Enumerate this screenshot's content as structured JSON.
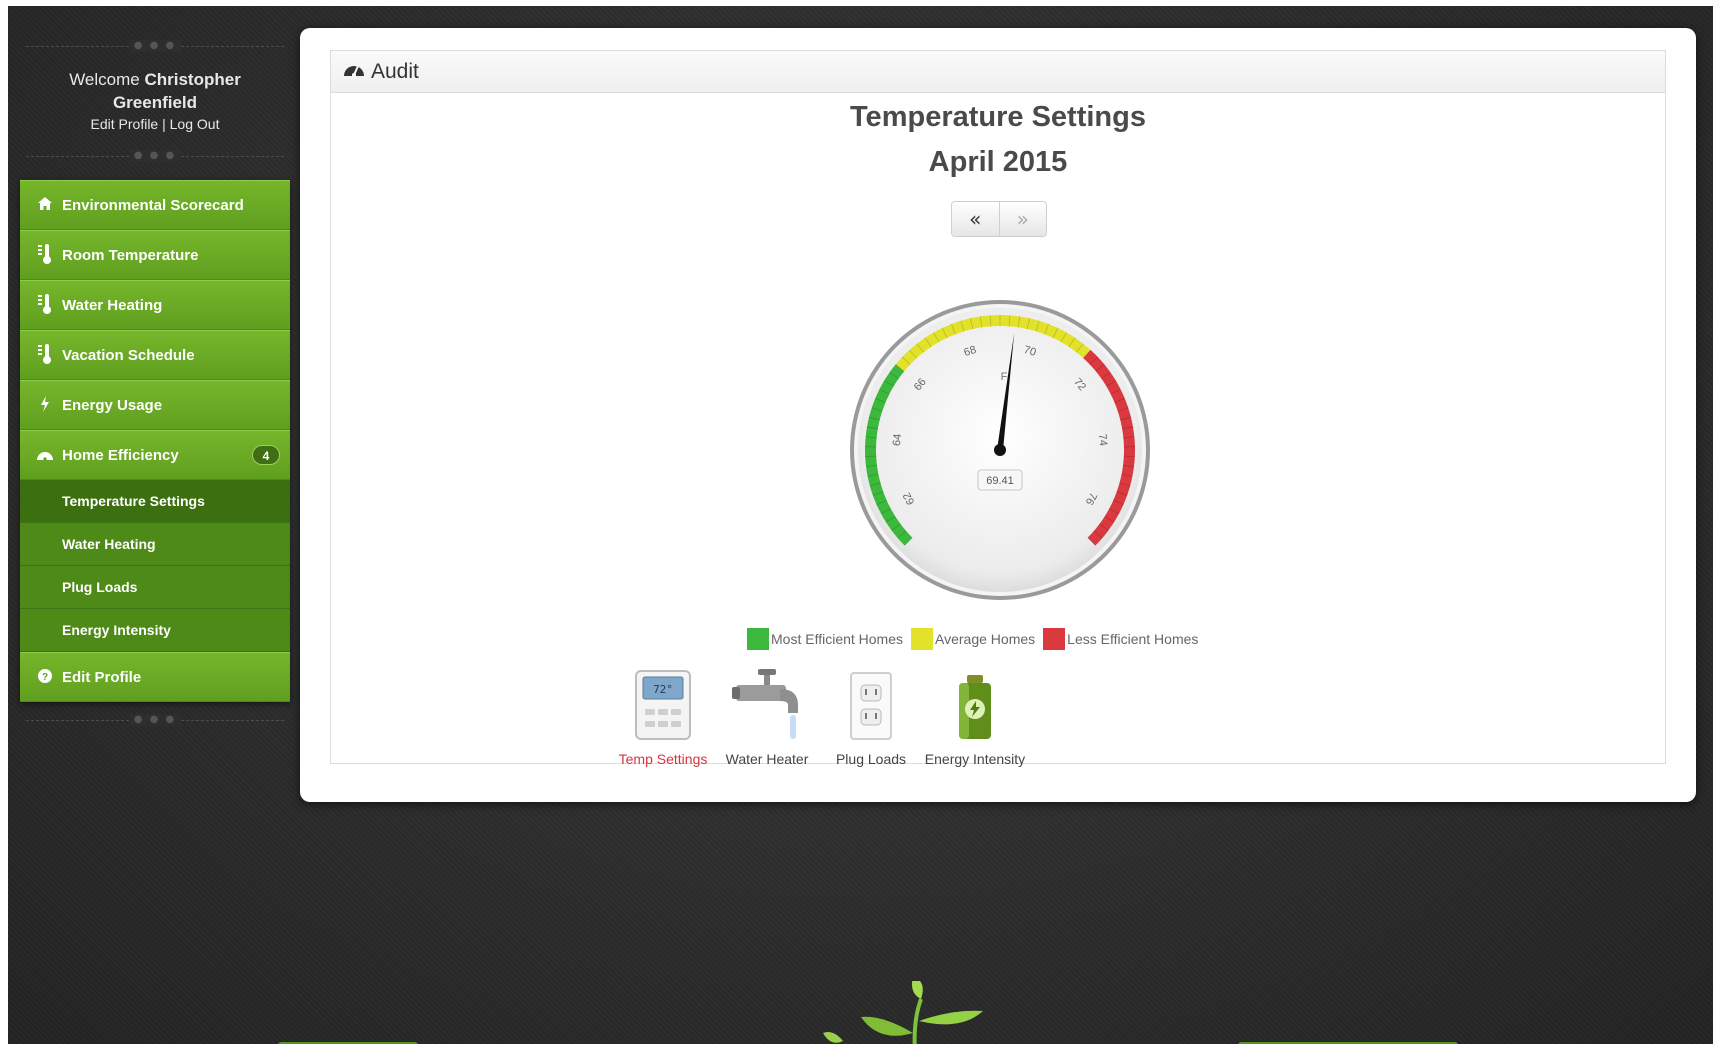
{
  "user": {
    "greeting": "Welcome",
    "first_name": "Christopher",
    "last_name": "Greenfield",
    "edit_profile": "Edit Profile",
    "separator": "|",
    "log_out": "Log Out"
  },
  "nav": {
    "items": [
      {
        "label": "Environmental Scorecard",
        "icon": "home-icon"
      },
      {
        "label": "Room Temperature",
        "icon": "thermometer-icon"
      },
      {
        "label": "Water Heating",
        "icon": "thermometer-icon"
      },
      {
        "label": "Vacation Schedule",
        "icon": "thermometer-icon"
      },
      {
        "label": "Energy Usage",
        "icon": "bolt-icon"
      },
      {
        "label": "Home Efficiency",
        "icon": "dashboard-icon",
        "badge": "4"
      }
    ],
    "sub_items": [
      {
        "label": "Temperature Settings",
        "active": true
      },
      {
        "label": "Water Heating"
      },
      {
        "label": "Plug Loads"
      },
      {
        "label": "Energy Intensity"
      }
    ],
    "edit_profile": {
      "label": "Edit Profile",
      "icon": "question-circle-icon"
    }
  },
  "card": {
    "header": "Audit",
    "header_icon": "dashboard-icon",
    "title": "Temperature Settings",
    "period": "April 2015",
    "prev_icon": "double-chevron-left-icon",
    "next_icon": "double-chevron-right-icon"
  },
  "gauge": {
    "value": 69.41,
    "value_label": "69.41",
    "unit": "F",
    "ticks": [
      62,
      64,
      66,
      68,
      70,
      72,
      74,
      76
    ],
    "min": 61,
    "max": 77,
    "bands": [
      {
        "from": 61,
        "to": 66,
        "color": "#3cb93c"
      },
      {
        "from": 66,
        "to": 71.5,
        "color": "#e2e22a"
      },
      {
        "from": 71.5,
        "to": 77,
        "color": "#d9393f"
      }
    ]
  },
  "legend": [
    {
      "label": "Most Efficient Homes",
      "color": "#3cb93c"
    },
    {
      "label": "Average Homes",
      "color": "#e2e22a"
    },
    {
      "label": "Less Efficient Homes",
      "color": "#d9393f"
    }
  ],
  "apps": [
    {
      "label": "Temp Settings",
      "icon": "thermostat-icon",
      "active": true
    },
    {
      "label": "Water Heater",
      "icon": "faucet-icon"
    },
    {
      "label": "Plug Loads",
      "icon": "outlet-icon"
    },
    {
      "label": "Energy Intensity",
      "icon": "battery-icon"
    }
  ],
  "colors": {
    "nav_green": "#6aab26",
    "sub_green": "#4d8a17",
    "active_app": "#d9333f"
  }
}
